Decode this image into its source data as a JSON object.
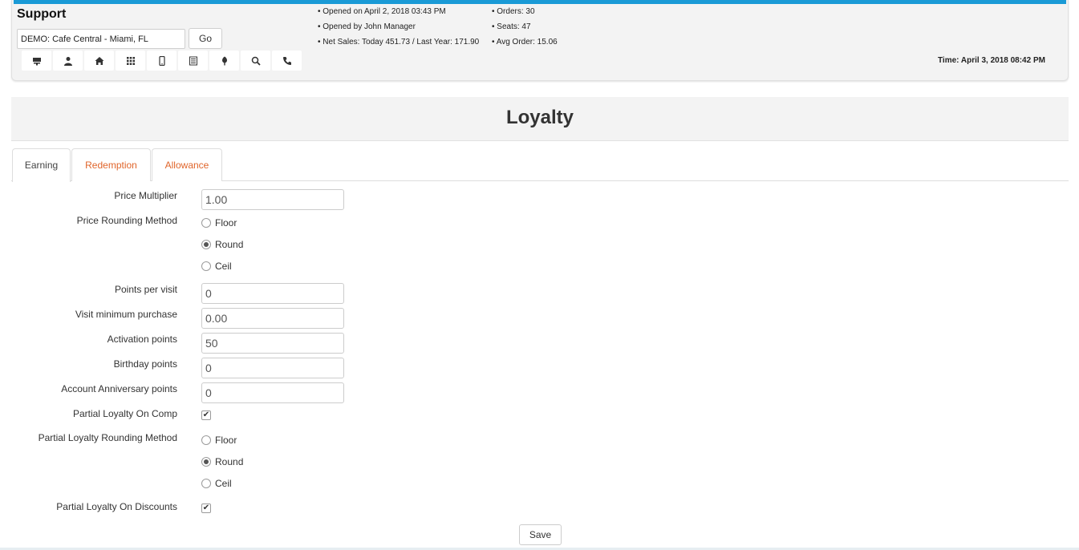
{
  "header": {
    "brand": "Support",
    "store_value": "DEMO: Cafe Central - Miami, FL",
    "go_label": "Go",
    "icons": [
      "pos-terminal-icon",
      "user-icon",
      "home-icon",
      "grid-icon",
      "mobile-icon",
      "list-icon",
      "tree-icon",
      "search-icon",
      "phone-icon"
    ],
    "info_left": [
      "• Opened on April 2, 2018 03:43 PM",
      "• Opened by John Manager",
      "• Net Sales: Today 451.73 / Last Year: 171.90"
    ],
    "info_right": [
      "• Orders: 30",
      "• Seats: 47",
      "• Avg Order: 15.06"
    ],
    "time": "Time: April 3, 2018 08:42 PM",
    "accent_color": "#1a9ad6"
  },
  "page": {
    "title": "Loyalty",
    "tabs": [
      {
        "label": "Earning",
        "active": true
      },
      {
        "label": "Redemption",
        "active": false
      },
      {
        "label": "Allowance",
        "active": false
      }
    ],
    "tab_color": "#e0652b"
  },
  "form": {
    "price_multiplier": {
      "label": "Price Multiplier",
      "value": "1.00"
    },
    "price_rounding": {
      "label": "Price Rounding Method",
      "options": [
        "Floor",
        "Round",
        "Ceil"
      ],
      "selected": "Round"
    },
    "points_per_visit": {
      "label": "Points per visit",
      "value": "0"
    },
    "visit_min_purchase": {
      "label": "Visit minimum purchase",
      "value": "0.00"
    },
    "activation_points": {
      "label": "Activation points",
      "value": "50"
    },
    "birthday_points": {
      "label": "Birthday points",
      "value": "0"
    },
    "anniversary_points": {
      "label": "Account Anniversary points",
      "value": "0"
    },
    "partial_on_comp": {
      "label": "Partial Loyalty On Comp",
      "checked": true
    },
    "partial_rounding": {
      "label": "Partial Loyalty Rounding Method",
      "options": [
        "Floor",
        "Round",
        "Ceil"
      ],
      "selected": "Round"
    },
    "partial_on_discounts": {
      "label": "Partial Loyalty On Discounts",
      "checked": true
    },
    "save_label": "Save"
  }
}
